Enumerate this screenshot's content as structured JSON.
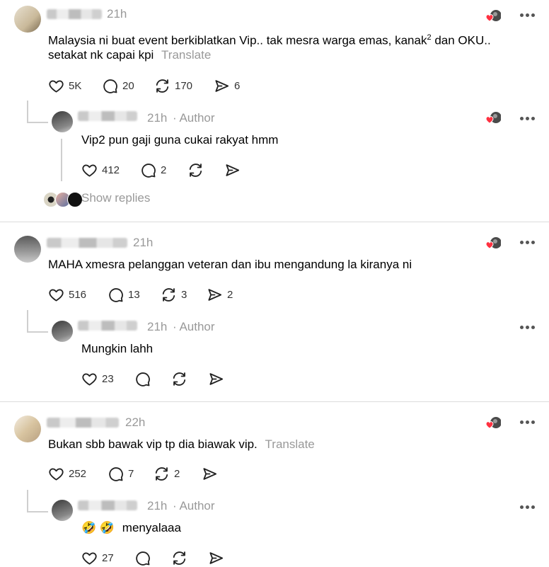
{
  "threads": [
    {
      "time": "21h",
      "text": "Malaysia ni buat event berkiblatkan Vip.. tak mesra warga emas, kanak",
      "text_sup": "2",
      "text_tail": " dan OKU..",
      "text_line2": "setakat nk capai kpi",
      "translate": "Translate",
      "likes": "5K",
      "comments": "20",
      "reposts": "170",
      "shares": "6",
      "reply": {
        "time": "21h",
        "author_label": "· Author",
        "text": "Vip2 pun gaji guna cukai rakyat hmm",
        "likes": "412",
        "comments": "2"
      },
      "show_replies": "Show replies"
    },
    {
      "time": "21h",
      "text": "MAHA xmesra pelanggan veteran dan ibu mengandung la kiranya ni",
      "likes": "516",
      "comments": "13",
      "reposts": "3",
      "shares": "2",
      "reply": {
        "time": "21h",
        "author_label": "· Author",
        "text": "Mungkin lahh",
        "likes": "23"
      }
    },
    {
      "time": "22h",
      "text": "Bukan sbb bawak vip tp dia biawak vip.",
      "translate": "Translate",
      "likes": "252",
      "comments": "7",
      "reposts": "2",
      "reply": {
        "time": "21h",
        "author_label": "· Author",
        "emoji": "🤣 🤣",
        "text": "menyalaaa",
        "likes": "27"
      }
    }
  ],
  "icons": {
    "like": "heart-icon",
    "comment": "comment-bubble-icon",
    "repost": "repost-icon",
    "share": "share-send-icon",
    "more": "more-options-icon",
    "reaction": "liked-by-author-icon"
  },
  "colors": {
    "heart": "#ff3040",
    "muted": "#999999",
    "divider": "#dcdcdc"
  }
}
